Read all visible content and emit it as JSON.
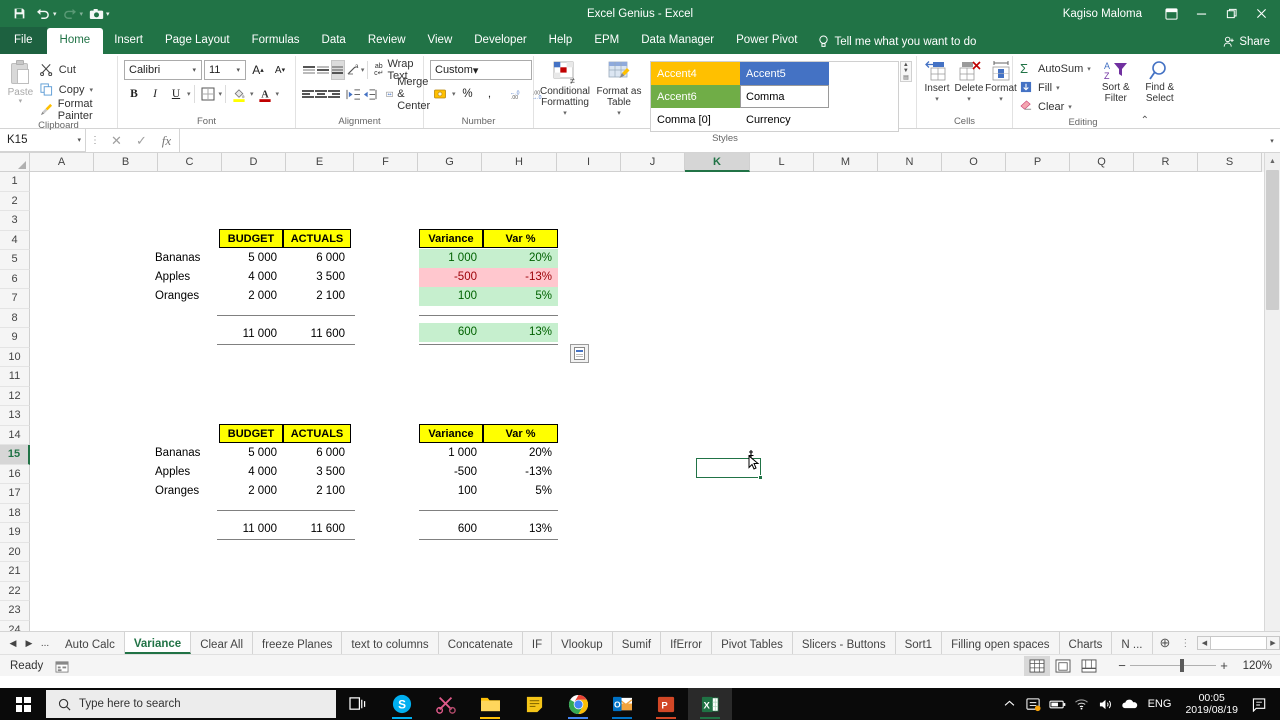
{
  "titlebar": {
    "title": "Excel Genius  -  Excel",
    "user": "Kagiso Maloma",
    "qat": [
      {
        "name": "save-icon",
        "glyph": "Ὃe"
      },
      {
        "name": "undo-icon",
        "glyph": "↶"
      },
      {
        "name": "redo-icon",
        "glyph": "↷"
      },
      {
        "name": "camera-icon",
        "glyph": "▣"
      },
      {
        "name": "customize-qat-icon",
        "glyph": "▾"
      }
    ],
    "ribbon_display_options": "⬜",
    "minimize": "─",
    "restore": "❐",
    "close": "✕"
  },
  "ribbon_tabs": {
    "file": "File",
    "items": [
      "Home",
      "Insert",
      "Page Layout",
      "Formulas",
      "Data",
      "Review",
      "View",
      "Developer",
      "Help",
      "EPM",
      "Data Manager",
      "Power Pivot"
    ],
    "active": "Home",
    "tellme": "Tell me what you want to do",
    "share": "Share"
  },
  "ribbon": {
    "clipboard": {
      "label": "Clipboard",
      "paste": "Paste",
      "cut": "Cut",
      "copy": "Copy",
      "format_painter": "Format Painter"
    },
    "font": {
      "label": "Font",
      "family": "Calibri",
      "size": "11",
      "grow": "A",
      "shrink": "A",
      "bold": "B",
      "italic": "I",
      "underline": "U",
      "borders": "⊞",
      "fill": "A",
      "color": "A"
    },
    "alignment": {
      "label": "Alignment",
      "wrap_text": "Wrap Text",
      "merge_center": "Merge & Center"
    },
    "number": {
      "label": "Number",
      "format": "Custom",
      "accounting": "$",
      "percent": "%",
      "comma": ",",
      "inc_dec": ".00",
      "dec_dec": ".00"
    },
    "styles": {
      "label": "Styles",
      "conditional_formatting": "Conditional Formatting",
      "format_as_table": "Format as Table",
      "gallery": [
        {
          "name": "Accent4",
          "bg": "#ffc000",
          "fg": "#ffffff",
          "selected": false
        },
        {
          "name": "Accent5",
          "bg": "#4472c4",
          "fg": "#ffffff",
          "selected": false
        },
        {
          "name": "Accent6",
          "bg": "#70ad47",
          "fg": "#ffffff",
          "selected": false
        },
        {
          "name": "Comma",
          "bg": "#ffffff",
          "fg": "#000000",
          "selected": true
        },
        {
          "name": "Comma [0]",
          "bg": "#ffffff",
          "fg": "#000000",
          "selected": false
        },
        {
          "name": "Currency",
          "bg": "#ffffff",
          "fg": "#000000",
          "selected": false
        }
      ]
    },
    "cells": {
      "label": "Cells",
      "insert": "Insert",
      "delete": "Delete",
      "format": "Format"
    },
    "editing": {
      "label": "Editing",
      "autosum": "AutoSum",
      "fill": "Fill",
      "clear": "Clear",
      "sort_filter_l1": "Sort &",
      "sort_filter_l2": "Filter",
      "find_select_l1": "Find &",
      "find_select_l2": "Select"
    }
  },
  "formula_bar": {
    "name_box": "K15",
    "cancel": "✕",
    "enter": "✓",
    "insert_function": "fx",
    "value": ""
  },
  "grid": {
    "columns": [
      "A",
      "B",
      "C",
      "D",
      "E",
      "F",
      "G",
      "H",
      "I",
      "J",
      "K",
      "L",
      "M",
      "N",
      "O",
      "P",
      "Q",
      "R",
      "S"
    ],
    "selected_column": "K",
    "rows": [
      "1",
      "2",
      "3",
      "4",
      "5",
      "6",
      "7",
      "8",
      "9",
      "10",
      "11",
      "12",
      "13",
      "14",
      "15",
      "16",
      "17",
      "18",
      "19",
      "20",
      "21",
      "22",
      "23",
      "24"
    ],
    "selected_row": "15",
    "selected_cell": "K15"
  },
  "table_data": {
    "headers_left": [
      "BUDGET",
      "ACTUALS"
    ],
    "headers_right": [
      "Variance",
      "Var %"
    ],
    "rows": [
      {
        "label": "Bananas",
        "budget": "5 000",
        "actuals": "6 000",
        "variance": "1 000",
        "var_pct": "20%",
        "status": "positive"
      },
      {
        "label": "Apples",
        "budget": "4 000",
        "actuals": "3 500",
        "variance": "-500",
        "var_pct": "-13%",
        "status": "negative"
      },
      {
        "label": "Oranges",
        "budget": "2 000",
        "actuals": "2 100",
        "variance": "100",
        "var_pct": "5%",
        "status": "positive"
      }
    ],
    "total": {
      "budget": "11 000",
      "actuals": "11 600",
      "variance": "600",
      "var_pct": "13%",
      "status": "positive"
    }
  },
  "colors": {
    "excel_green": "#217346",
    "header_yellow": "#ffff00",
    "good_fill": "#c6efce",
    "good_text": "#006100",
    "bad_fill": "#ffc7ce",
    "bad_text": "#9c0006"
  },
  "sheet_tabs": {
    "prev": "◀",
    "next": "▶",
    "overflow": "...",
    "items": [
      "Auto Calc",
      "Variance",
      "Clear All",
      "freeze Planes",
      "text to columns",
      "Concatenate",
      "IF",
      "Vlookup",
      "Sumif",
      "IfError",
      "Pivot Tables",
      "Slicers - Buttons",
      "Sort1",
      "Filling open spaces",
      "Charts",
      "N ..."
    ],
    "active": "Variance",
    "add": "⊕",
    "more": "⋮"
  },
  "statusbar": {
    "status": "Ready",
    "views": [
      "normal-view",
      "page-layout-view",
      "page-break-view"
    ],
    "active_view": "normal-view",
    "zoom_out": "−",
    "zoom_in": "+",
    "zoom_level": "120%"
  },
  "taskbar": {
    "search_placeholder": "Type here to search",
    "apps": [
      {
        "name": "task-view-icon",
        "label": "Task View"
      },
      {
        "name": "skype-icon",
        "label": "Skype"
      },
      {
        "name": "snip-icon",
        "label": "Snip & Sketch"
      },
      {
        "name": "file-explorer-icon",
        "label": "File Explorer"
      },
      {
        "name": "sticky-notes-icon",
        "label": "Sticky Notes"
      },
      {
        "name": "chrome-icon",
        "label": "Google Chrome"
      },
      {
        "name": "outlook-icon",
        "label": "Outlook"
      },
      {
        "name": "powerpoint-icon",
        "label": "PowerPoint"
      },
      {
        "name": "excel-icon",
        "label": "Excel"
      }
    ],
    "tray": {
      "language": "ENG",
      "time": "00:05",
      "date": "2019/08/19"
    }
  }
}
